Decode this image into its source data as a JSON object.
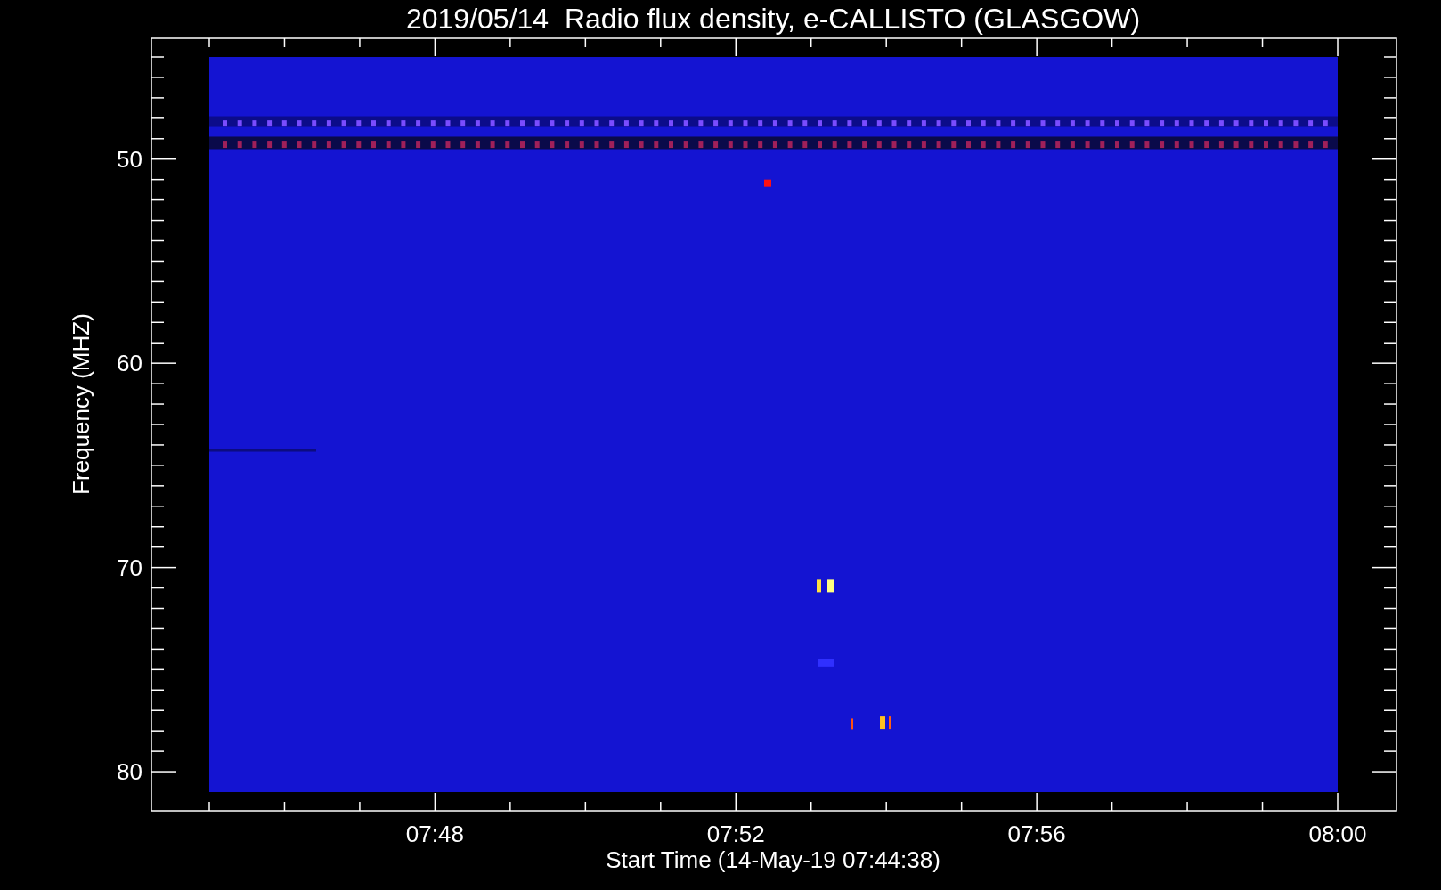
{
  "title": "2019/05/14  Radio flux density, e-CALLISTO (GLASGOW)",
  "xlabel": "Start Time (14-May-19 07:44:38)",
  "ylabel": "Frequency (MHZ)",
  "xticks": [
    "07:48",
    "07:52",
    "07:56",
    "08:00"
  ],
  "yticks": [
    "50",
    "60",
    "70",
    "80"
  ]
}
